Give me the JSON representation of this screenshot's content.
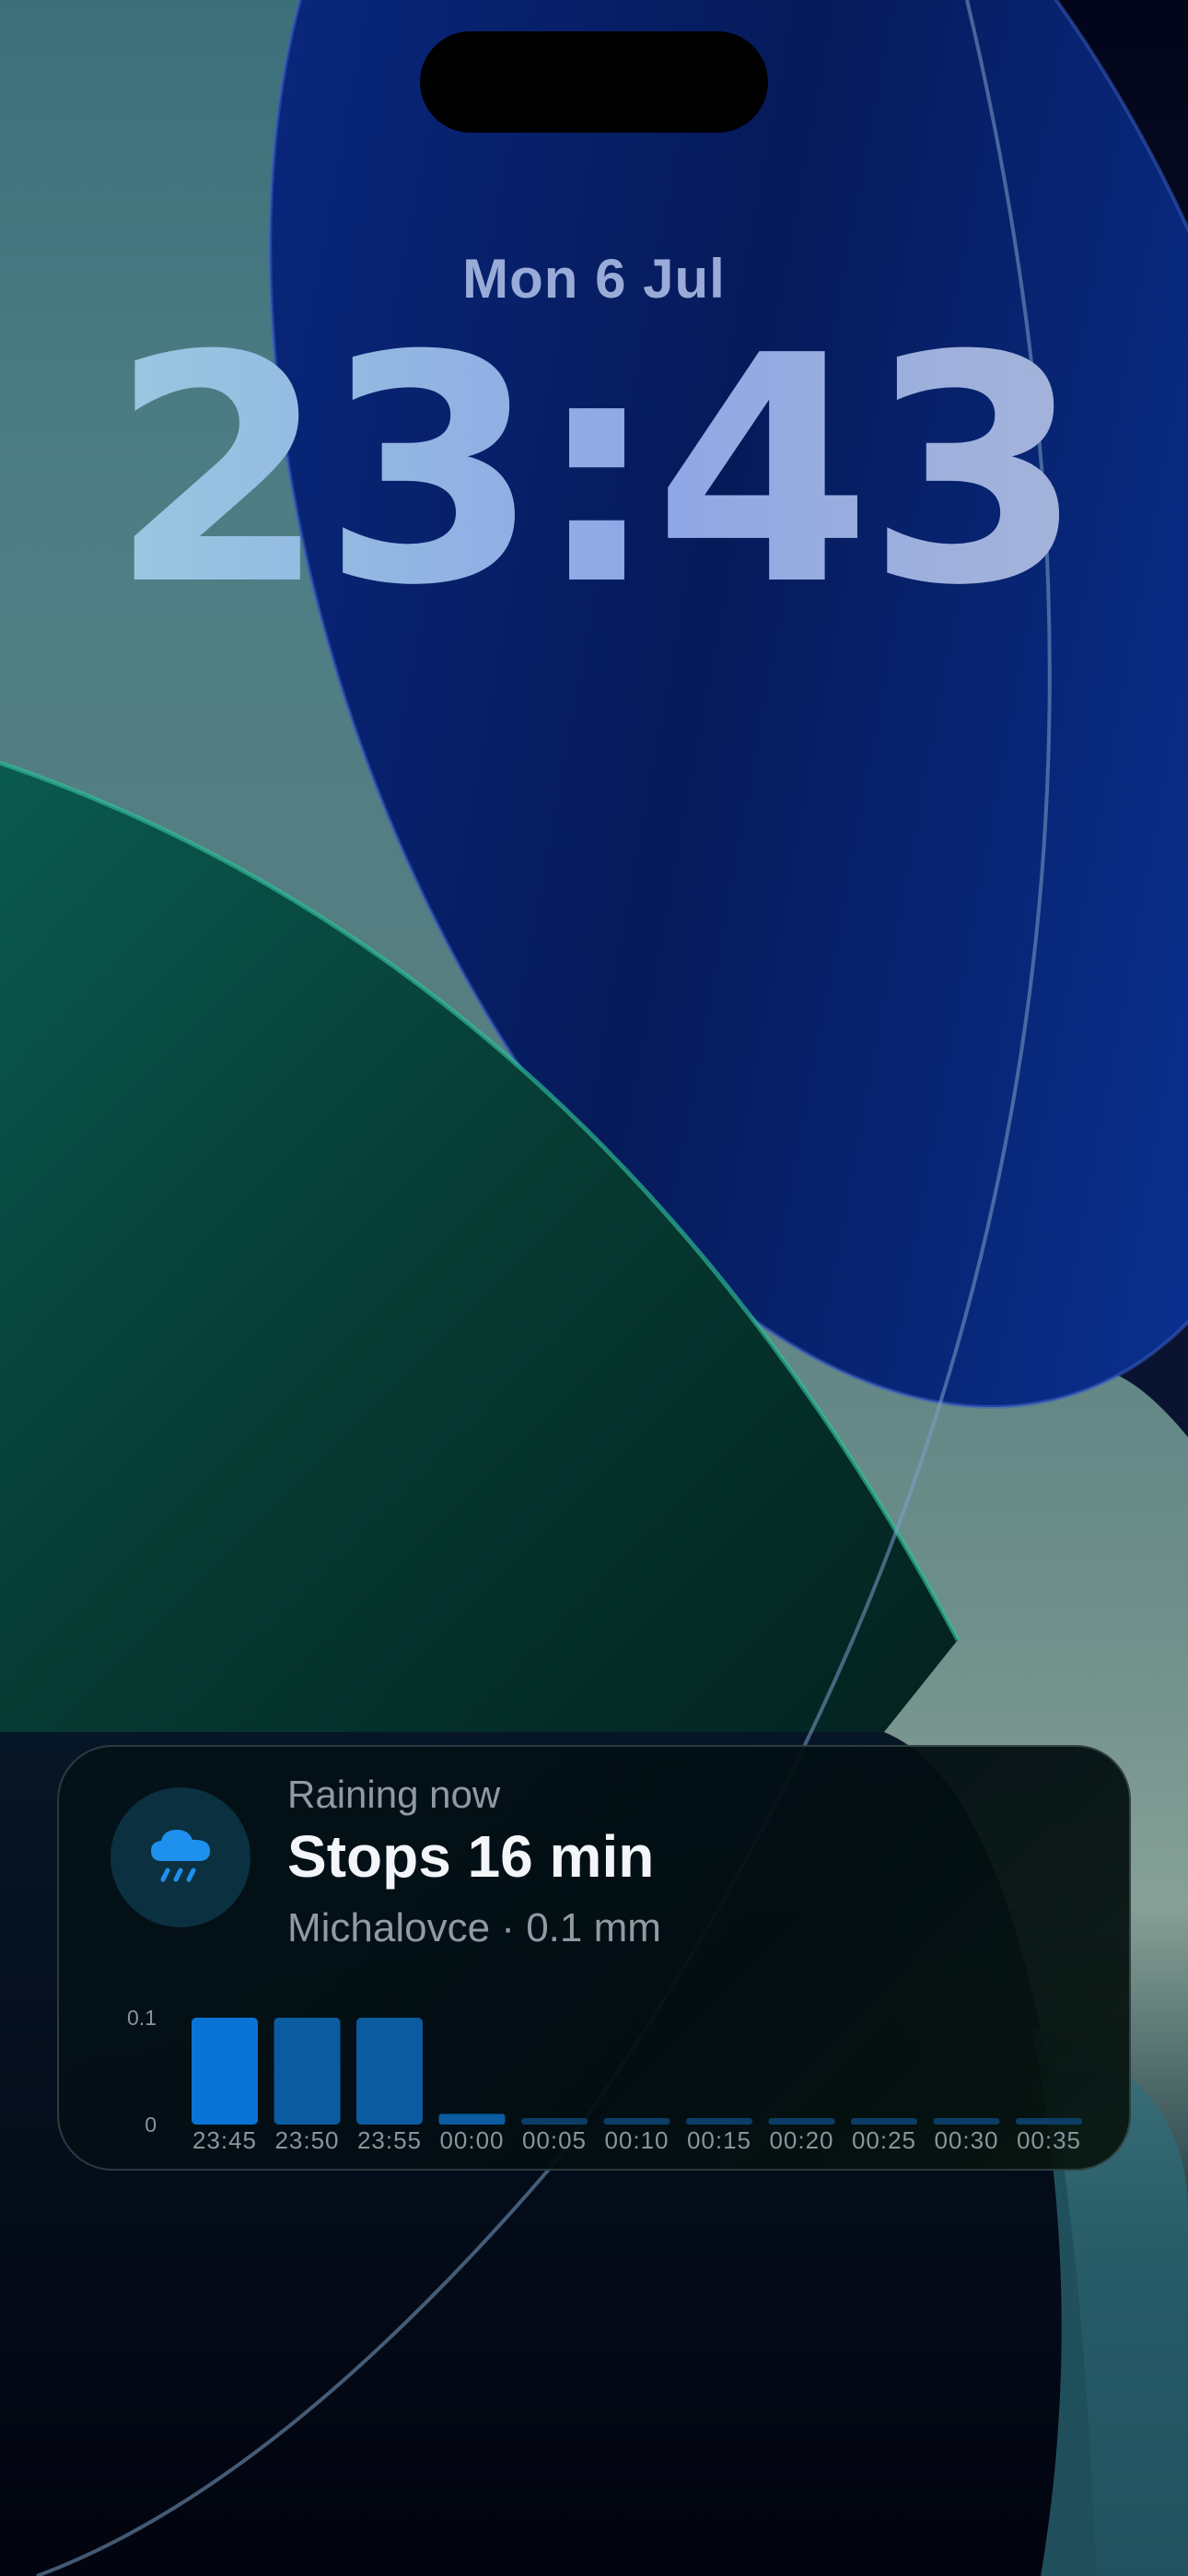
{
  "lock_screen": {
    "date": "Mon 6 Jul",
    "time": "23:43"
  },
  "weather_widget": {
    "icon": "cloud-rain-icon",
    "status": "Raining now",
    "headline": "Stops 16 min",
    "subtitle": "Michalovce · 0.1 mm"
  },
  "colors": {
    "bar_now": "#0a74d6",
    "bar": "#0a5ba0",
    "bar_trace": "#0c3d66",
    "icon_cloud": "#1e90ee"
  },
  "chart_data": {
    "type": "bar",
    "categories": [
      "23:45",
      "23:50",
      "23:55",
      "00:00",
      "00:05",
      "00:10",
      "00:15",
      "00:20",
      "00:25",
      "00:30",
      "00:35"
    ],
    "values": [
      0.1,
      0.1,
      0.1,
      0.01,
      0.0,
      0.0,
      0.0,
      0.0,
      0.0,
      0.0,
      0.0
    ],
    "y_ticks": [
      "0.1",
      "0"
    ],
    "ylim": [
      0,
      0.1
    ],
    "grid": false,
    "legend": "none"
  }
}
